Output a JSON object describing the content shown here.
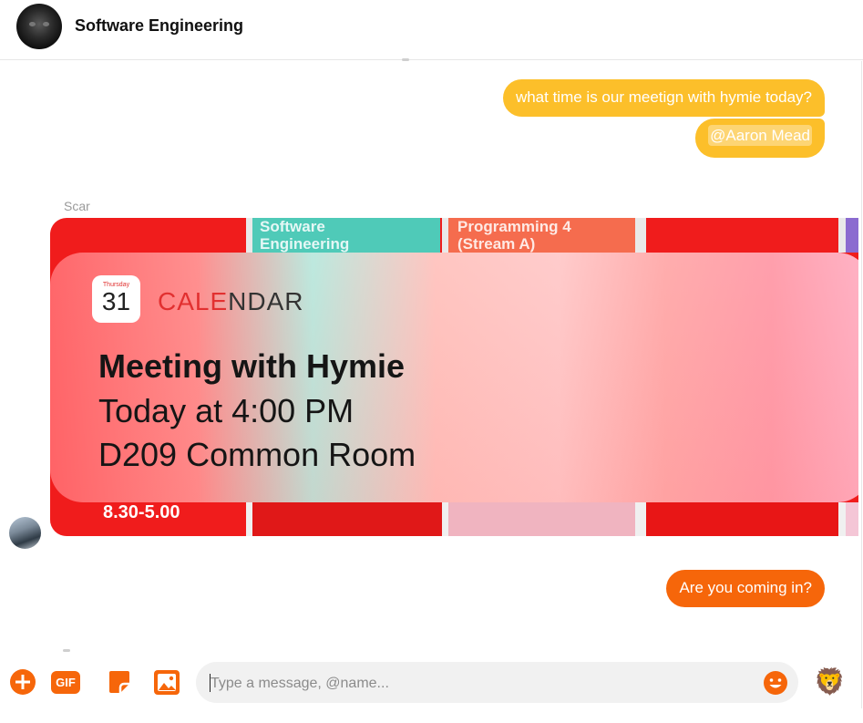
{
  "conversation": {
    "title": "Software Engineering"
  },
  "messages": {
    "outgoing_1": "what time is our meetign with hymie today?",
    "outgoing_2_mention": "@Aaron Mead",
    "incoming_sender": "Scar",
    "shared_image": {
      "timetable_cells": [
        "Software\nEngineering",
        "Programming 4\n(Stream A)"
      ],
      "notification_day": "Thursday",
      "notification_date": "31",
      "notification_app": "CALENDAR",
      "event_title": "Meeting with Hymie",
      "event_time": "Today at 4:00 PM",
      "event_location": "D209 Common Room",
      "hours_label": "8.30-5.00"
    },
    "outgoing_3": "Are you coming in?"
  },
  "composer": {
    "placeholder": "Type a message, @name...",
    "gif_label": "GIF",
    "reaction_emoji": "🦁"
  },
  "colors": {
    "yellow_bubble": "#fcbf2a",
    "orange_bubble": "#f6660a",
    "accent": "#f6660a"
  }
}
